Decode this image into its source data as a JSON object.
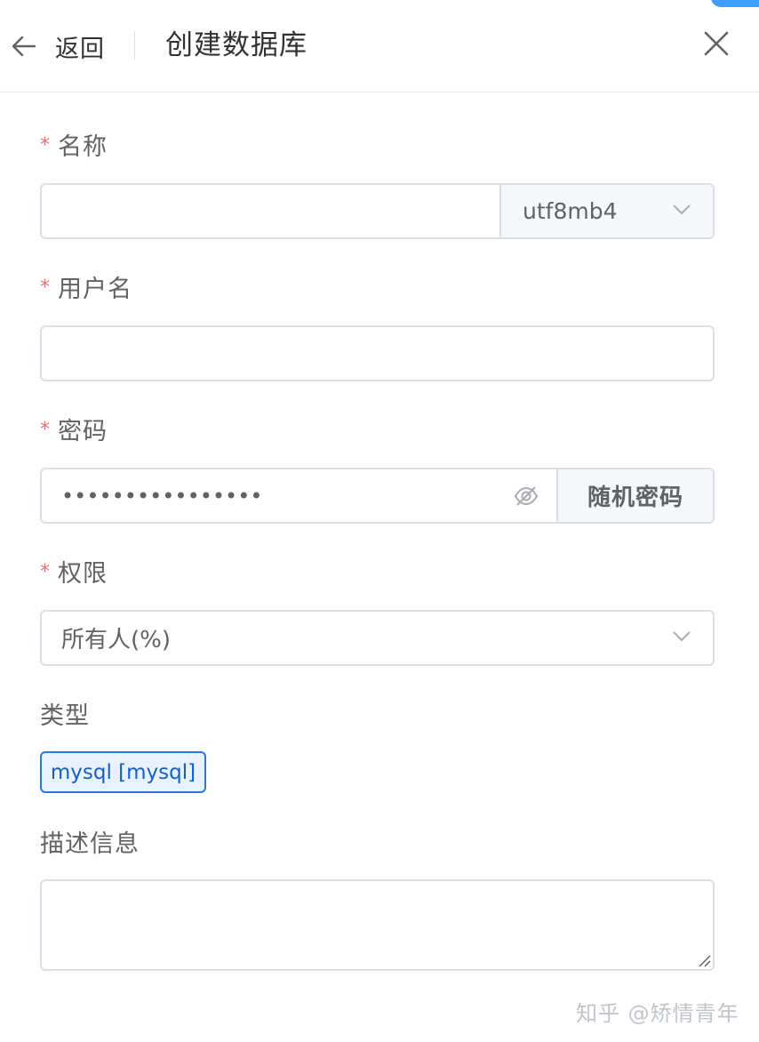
{
  "header": {
    "back_label": "返回",
    "title": "创建数据库"
  },
  "form": {
    "name": {
      "label": "名称",
      "value": "",
      "charset": "utf8mb4"
    },
    "username": {
      "label": "用户名",
      "value": ""
    },
    "password": {
      "label": "密码",
      "masked_value": "••••••••••••••••",
      "random_button": "随机密码"
    },
    "permission": {
      "label": "权限",
      "selected": "所有人(%)"
    },
    "type": {
      "label": "类型",
      "tag": "mysql [mysql]"
    },
    "description": {
      "label": "描述信息",
      "value": ""
    },
    "required_mark": "*"
  },
  "watermark": "知乎 @矫情青年",
  "colors": {
    "required": "#f56c6c",
    "accent": "#409eff",
    "tag_border": "#2b78d8",
    "tag_text": "#1660c4",
    "border": "#dcdfe6"
  }
}
